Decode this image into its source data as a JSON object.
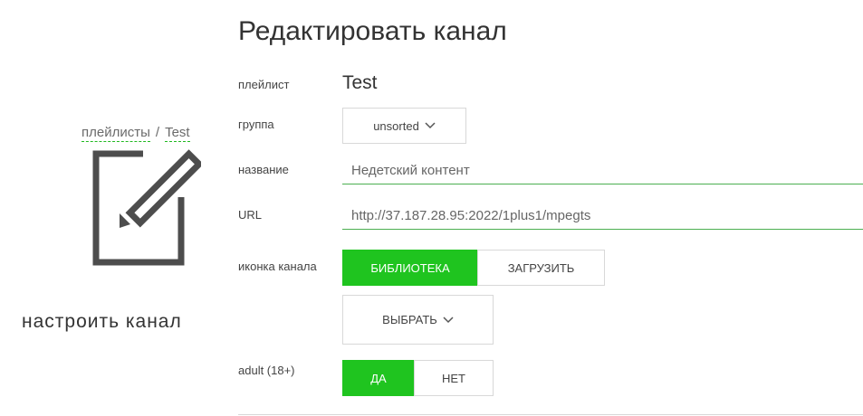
{
  "breadcrumb": {
    "playlists": "плейлисты",
    "separator": "/",
    "current": "Test"
  },
  "sidebar": {
    "title": "настроить канал",
    "icon": "edit-square-icon"
  },
  "page_title": "Редактировать канал",
  "fields": {
    "playlist": {
      "label": "плейлист",
      "value": "Test"
    },
    "group": {
      "label": "группа",
      "value": "unsorted"
    },
    "name": {
      "label": "название",
      "value": "Недетский контент"
    },
    "url": {
      "label": "URL",
      "value": "http://37.187.28.95:2022/1plus1/mpegts"
    },
    "icon": {
      "label": "иконка канала",
      "library": "БИБЛИОТЕКА",
      "upload": "ЗАГРУЗИТЬ",
      "select": "ВЫБРАТЬ",
      "active_tab": "library"
    },
    "adult": {
      "label": "adult (18+)",
      "yes": "ДА",
      "no": "НЕТ",
      "value": "yes"
    }
  },
  "colors": {
    "accent": "#1fc41f",
    "underline": "#4caf50",
    "text": "#333333",
    "border": "#d8d8d8"
  }
}
